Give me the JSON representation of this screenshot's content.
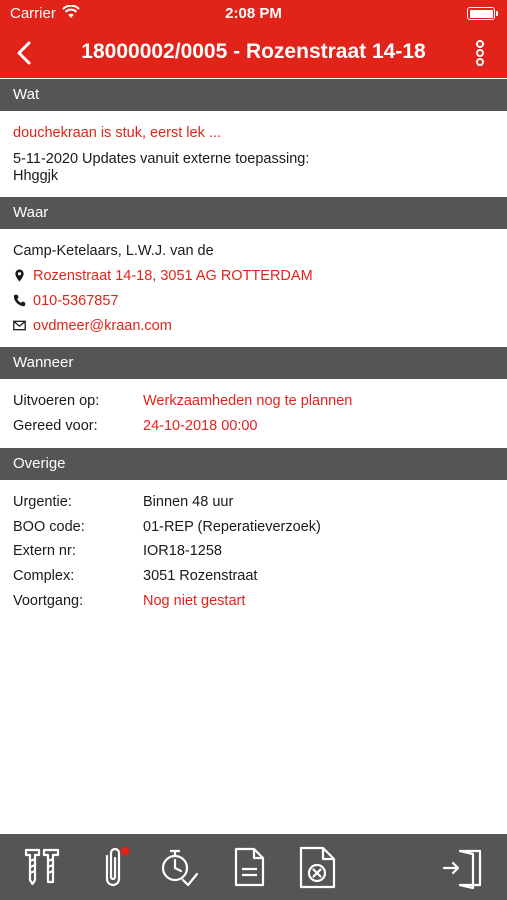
{
  "status_bar": {
    "carrier": "Carrier",
    "time": "2:08 PM"
  },
  "nav": {
    "title": "18000002/0005 - Rozenstraat 14-18"
  },
  "sections": {
    "wat": {
      "header": "Wat",
      "description": "douchekraan is stuk, eerst lek  ...",
      "note_line1": "5-11-2020 Updates vanuit externe toepassing:",
      "note_line2": "Hhggjk"
    },
    "waar": {
      "header": "Waar",
      "name": "Camp-Ketelaars, L.W.J. van de",
      "address": "Rozenstraat 14-18, 3051 AG ROTTERDAM",
      "phone": "010-5367857",
      "email": "ovdmeer@kraan.com"
    },
    "wanneer": {
      "header": "Wanneer",
      "rows": [
        {
          "label": "Uitvoeren op:",
          "value": "Werkzaamheden nog te plannen"
        },
        {
          "label": "Gereed voor:",
          "value": "24-10-2018 00:00"
        }
      ]
    },
    "overige": {
      "header": "Overige",
      "rows": [
        {
          "label": "Urgentie:",
          "value": "Binnen 48 uur"
        },
        {
          "label": "BOO code:",
          "value": "01-REP (Reperatieverzoek)"
        },
        {
          "label": "Extern nr:",
          "value": "IOR18-1258"
        },
        {
          "label": "Complex:",
          "value": "3051 Rozenstraat"
        },
        {
          "label": "Voortgang:",
          "value": "Nog niet gestart"
        }
      ]
    }
  },
  "icons": {
    "back": "chevron-left-icon",
    "more": "more-vertical-icon",
    "location": "map-pin-icon",
    "phone": "phone-icon",
    "email": "envelope-icon",
    "toolbar": [
      "tools-icon",
      "attachment-icon",
      "timer-check-icon",
      "document-icon",
      "cancel-document-icon",
      "logout-icon"
    ]
  },
  "colors": {
    "accent": "#e2231a",
    "section_bg": "#555555",
    "toolbar_bg": "#555555",
    "notification_dot": "#e2231a"
  }
}
